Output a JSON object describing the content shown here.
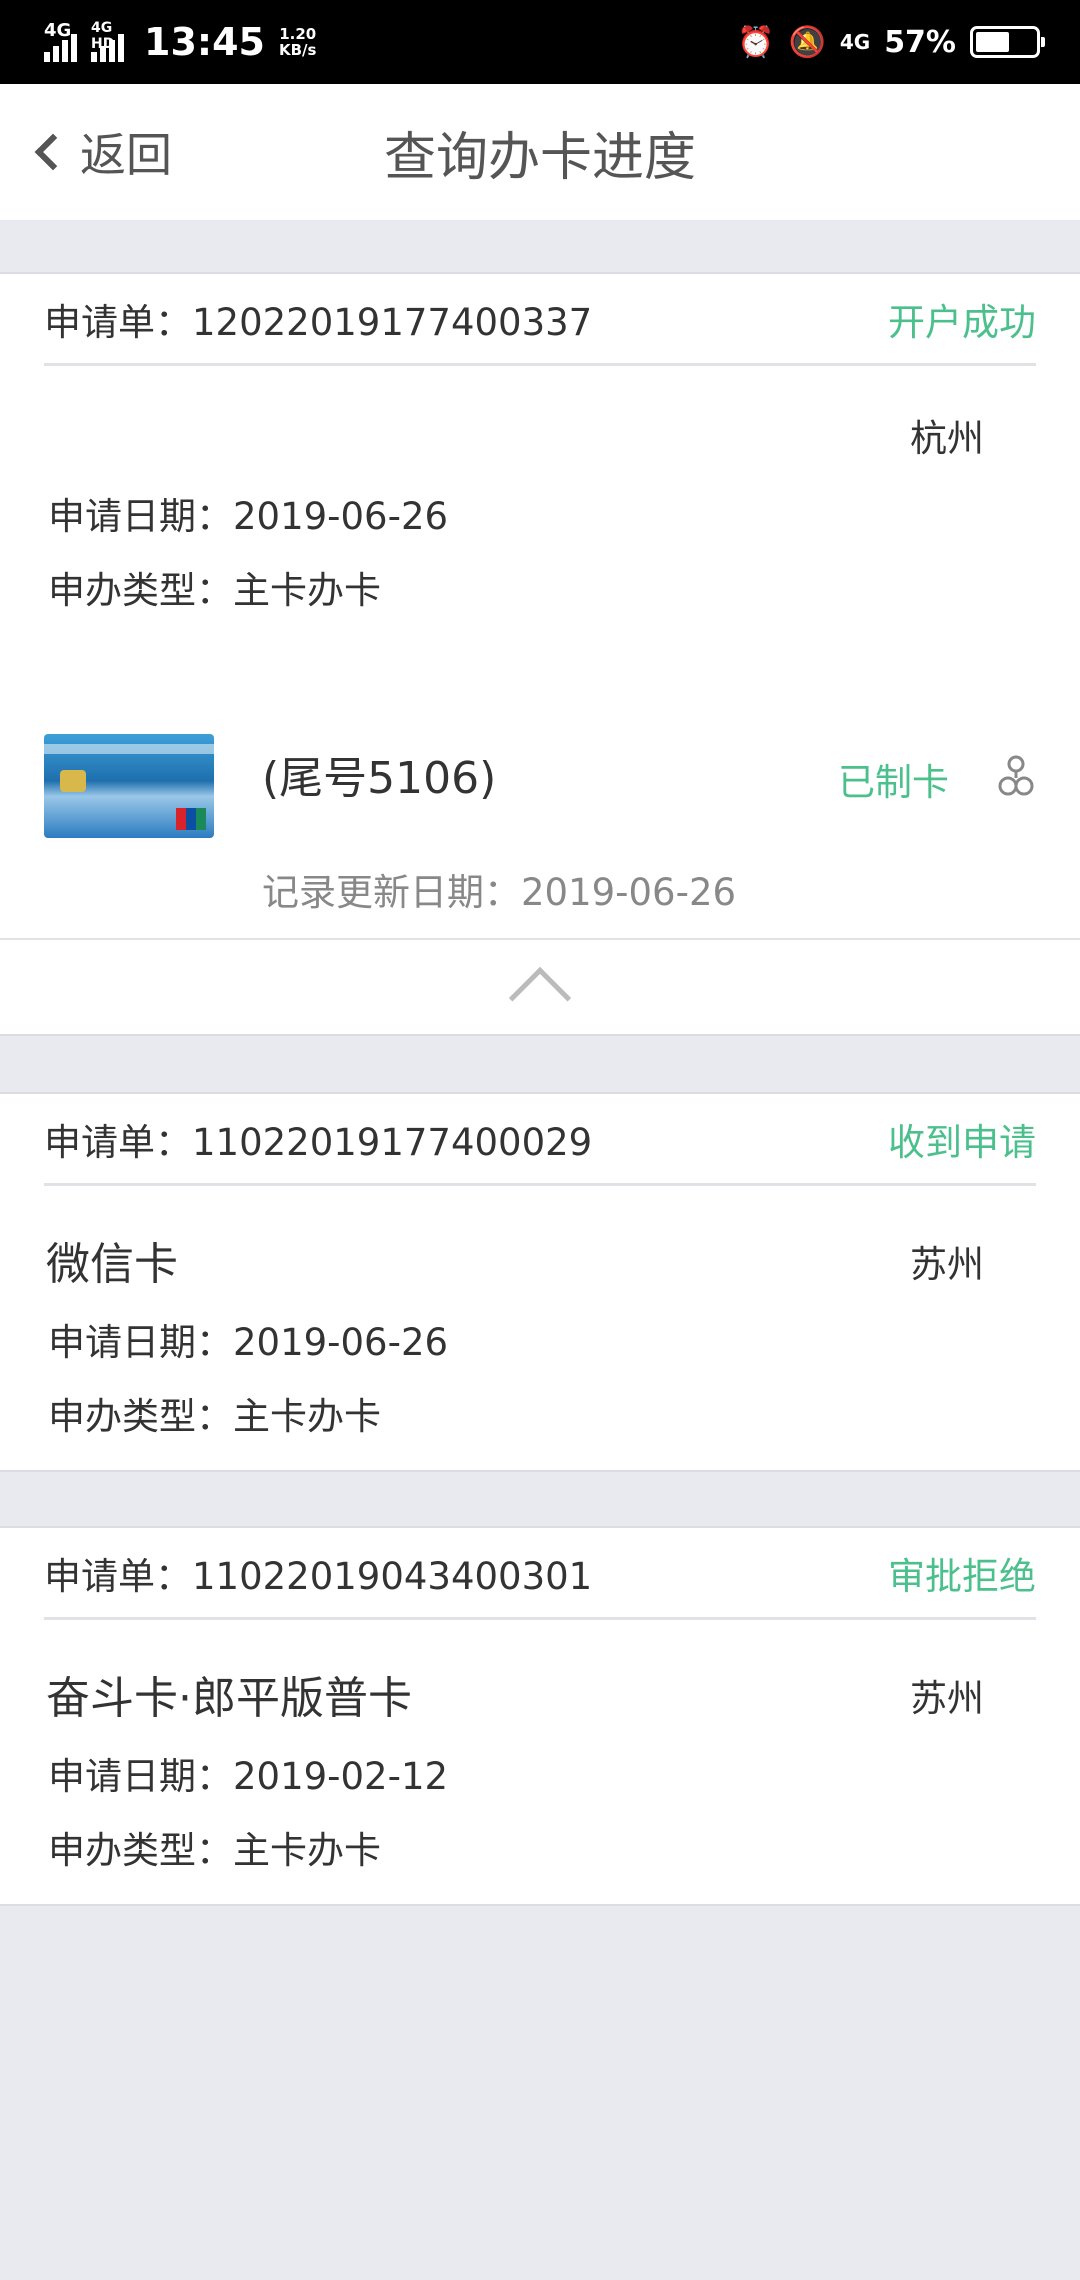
{
  "status_bar": {
    "net1": "4G",
    "net2": "4G HD",
    "time": "13:45",
    "speed_value": "1.20",
    "speed_unit": "KB/s",
    "net3": "4G",
    "battery_pct": "57%",
    "battery_level": 0.57,
    "icons": [
      "alarm-icon",
      "mute-icon",
      "signal-icon",
      "battery-icon"
    ]
  },
  "nav": {
    "back_label": "返回",
    "title": "查询办卡进度"
  },
  "applications": [
    {
      "number_label": "申请单：12022019177400337",
      "status": "开户成功",
      "product": "",
      "city": "杭州",
      "date_label": "申请日期：2019-06-26",
      "type_label": "申办类型：主卡办卡",
      "card": {
        "tail_label": "(尾号5106)",
        "status": "已制卡",
        "update_label": "记录更新日期：2019-06-26"
      }
    },
    {
      "number_label": "申请单：11022019177400029",
      "status": "收到申请",
      "product": "微信卡",
      "city": "苏州",
      "date_label": "申请日期：2019-06-26",
      "type_label": "申办类型：主卡办卡"
    },
    {
      "number_label": "申请单：11022019043400301",
      "status": "审批拒绝",
      "product": "奋斗卡·郎平版普卡",
      "city": "苏州",
      "date_label": "申请日期：2019-02-12",
      "type_label": "申办类型：主卡办卡"
    }
  ],
  "colors": {
    "accent_green": "#4cc08c",
    "background": "#e9e9f0"
  }
}
